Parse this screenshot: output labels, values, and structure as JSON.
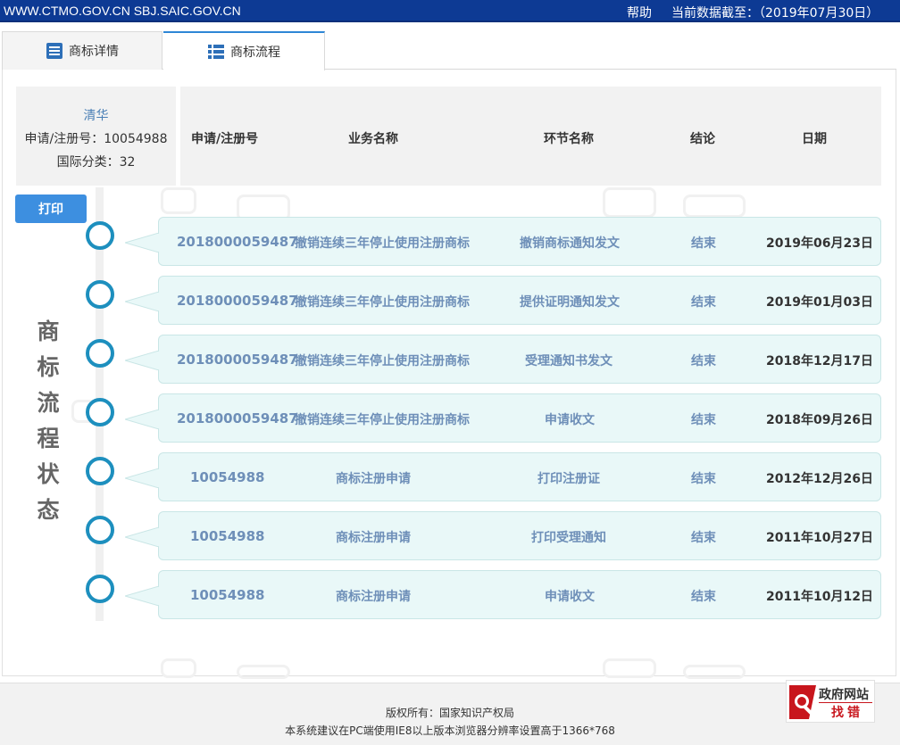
{
  "topbar": {
    "sites": "WWW.CTMO.GOV.CN SBJ.SAIC.GOV.CN",
    "help": "帮助",
    "as_of": "当前数据截至：（2019年07月30日）"
  },
  "tabs": [
    {
      "label": "商标详情",
      "icon": "document-list-icon",
      "active": false
    },
    {
      "label": "商标流程",
      "icon": "list-icon",
      "active": true
    }
  ],
  "info": {
    "name": "清华",
    "reg_line": "申请/注册号：10054988",
    "class_line": "国际分类：32"
  },
  "headers": {
    "reg_no": "申请/注册号",
    "business": "业务名称",
    "step": "环节名称",
    "result": "结论",
    "date": "日期"
  },
  "print_label": "打印",
  "side_label": [
    "商",
    "标",
    "流",
    "程",
    "状",
    "态"
  ],
  "records": [
    {
      "reg_no": "2018000059487",
      "business": "撤销连续三年停止使用注册商标",
      "step": "撤销商标通知发文",
      "result": "结束",
      "date": "2019年06月23日"
    },
    {
      "reg_no": "2018000059487",
      "business": "撤销连续三年停止使用注册商标",
      "step": "提供证明通知发文",
      "result": "结束",
      "date": "2019年01月03日"
    },
    {
      "reg_no": "2018000059487",
      "business": "撤销连续三年停止使用注册商标",
      "step": "受理通知书发文",
      "result": "结束",
      "date": "2018年12月17日"
    },
    {
      "reg_no": "2018000059487",
      "business": "撤销连续三年停止使用注册商标",
      "step": "申请收文",
      "result": "结束",
      "date": "2018年09月26日"
    },
    {
      "reg_no": "10054988",
      "business": "商标注册申请",
      "step": "打印注册证",
      "result": "结束",
      "date": "2012年12月26日"
    },
    {
      "reg_no": "10054988",
      "business": "商标注册申请",
      "step": "打印受理通知",
      "result": "结束",
      "date": "2011年10月27日"
    },
    {
      "reg_no": "10054988",
      "business": "商标注册申请",
      "step": "申请收文",
      "result": "结束",
      "date": "2011年10月12日"
    }
  ],
  "footer": {
    "copyright": "版权所有：国家知识产权局",
    "note": "本系统建议在PC端使用IE8以上版本浏览器分辨率设置高于1366*768"
  },
  "badge": {
    "title": "政府网站",
    "action": "找错"
  },
  "colors": {
    "topbar": "#0d3a94",
    "accent": "#1d8fbe",
    "button": "#3d8fe0",
    "row_bg": "#e9f8f8",
    "link_text": "#6e8fb8",
    "badge_red": "#c8161d"
  }
}
